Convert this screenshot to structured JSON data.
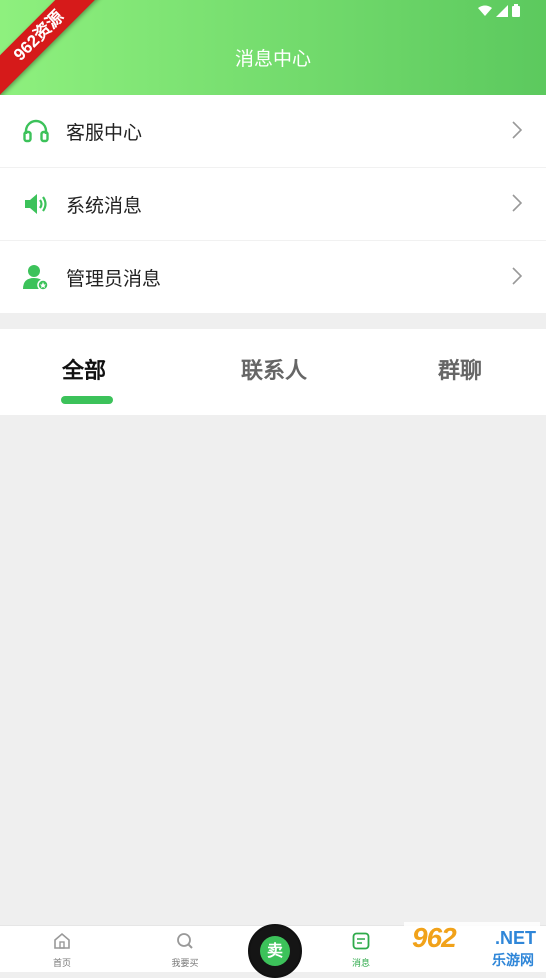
{
  "header": {
    "title": "消息中心",
    "ribbon": "962资源"
  },
  "status_icons": [
    "wifi-icon",
    "signal-icon",
    "battery-icon"
  ],
  "menu": [
    {
      "label": "客服中心",
      "icon": "headset-icon"
    },
    {
      "label": "系统消息",
      "icon": "speaker-icon"
    },
    {
      "label": "管理员消息",
      "icon": "admin-user-icon"
    }
  ],
  "tabs": [
    {
      "label": "全部",
      "active": true
    },
    {
      "label": "联系人",
      "active": false
    },
    {
      "label": "群聊",
      "active": false
    }
  ],
  "bottom_nav": [
    {
      "label": "首页",
      "icon": "home-icon"
    },
    {
      "label": "我要买",
      "icon": "search-icon"
    },
    {
      "label": "卖",
      "icon": "sell-frog-icon"
    },
    {
      "label": "消息",
      "icon": "message-icon",
      "active": true
    }
  ],
  "watermark": {
    "brand": "962",
    "suffix": ".NET",
    "sub": "乐游网"
  },
  "colors": {
    "accent": "#3cc25a",
    "header_start": "#8ef07e",
    "header_end": "#5cc95e"
  }
}
